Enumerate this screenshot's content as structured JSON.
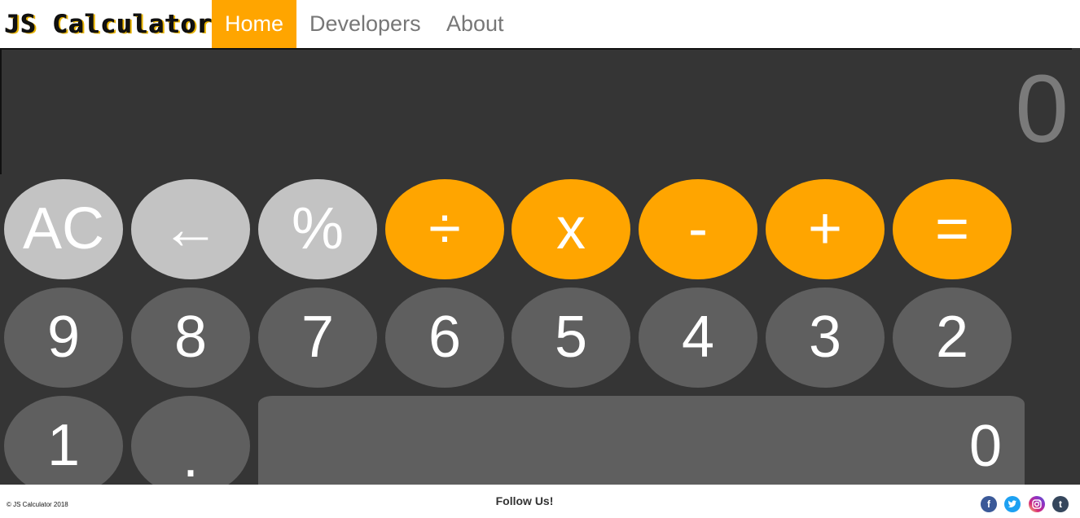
{
  "navbar": {
    "logo": "JS Calculator",
    "links": [
      {
        "label": "Home",
        "active": true
      },
      {
        "label": "Developers",
        "active": false
      },
      {
        "label": "About",
        "active": false
      }
    ]
  },
  "calculator": {
    "display_value": "0",
    "keys": {
      "row1": [
        "AC",
        "←",
        "%",
        "÷",
        "x",
        "-",
        "+",
        "="
      ],
      "row2": [
        "9",
        "8",
        "7",
        "6",
        "5",
        "4",
        "3",
        "2"
      ],
      "row3": [
        "1",
        ".",
        "0"
      ]
    },
    "colors": {
      "accent": "#ffa500",
      "utility_key": "#c3c3c3",
      "number_key": "#5f5f5f",
      "background": "#353535"
    }
  },
  "footer": {
    "copyright": "© JS Calculator 2018",
    "follow_text": "Follow Us!",
    "social": [
      {
        "icon": "facebook-icon",
        "glyph": "f"
      },
      {
        "icon": "twitter-icon",
        "glyph": "🐦"
      },
      {
        "icon": "instagram-icon",
        "glyph": "◎"
      },
      {
        "icon": "tumblr-icon",
        "glyph": "t"
      }
    ]
  }
}
